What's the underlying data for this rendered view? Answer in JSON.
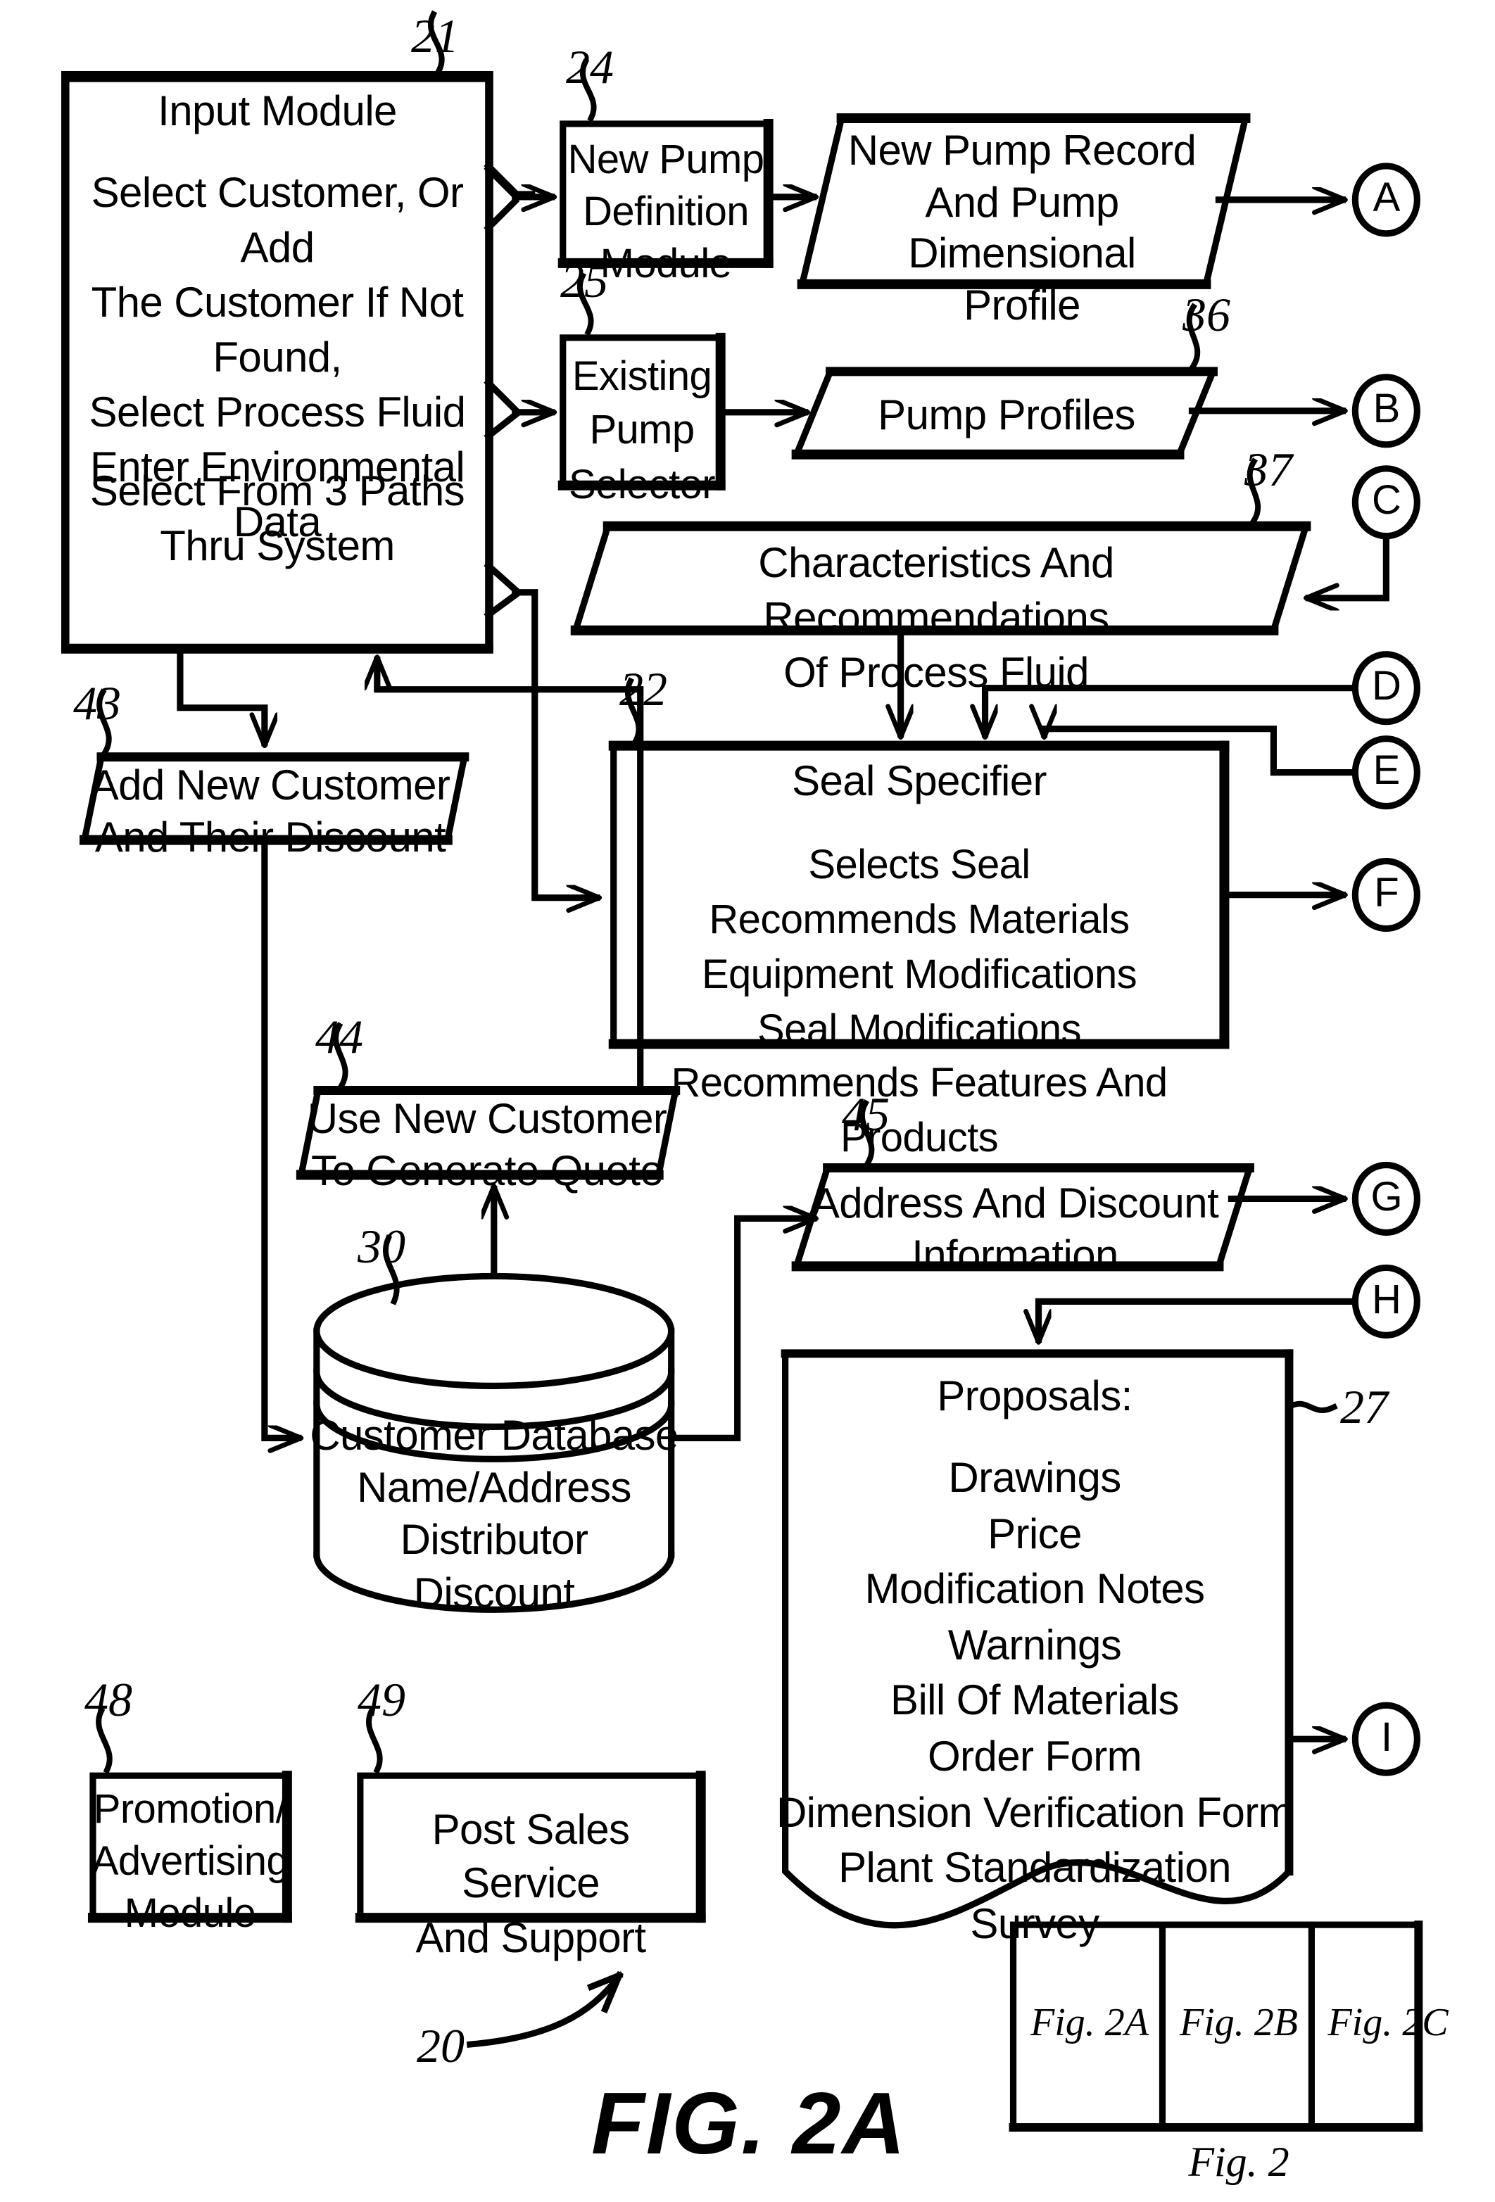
{
  "figure": {
    "caption": "FIG. 2A",
    "system_ref": "20"
  },
  "nodes": {
    "input_module": {
      "ref": "21",
      "title": "Input Module",
      "body": "Select Customer, Or Add\nThe Customer If Not\nFound,\nSelect Process Fluid\nEnter Environmental\nData",
      "body2": "Select From 3 Paths\nThru System"
    },
    "new_pump_definition": {
      "ref": "24",
      "label": "New Pump\nDefinition\nModule"
    },
    "new_pump_record": {
      "label": "New Pump Record\nAnd Pump\nDimensional\nProfile"
    },
    "existing_pump_selector": {
      "ref": "25",
      "label": "Existing\nPump\nSelector"
    },
    "pump_profiles": {
      "ref": "36",
      "label": "Pump Profiles"
    },
    "characteristics": {
      "ref": "37",
      "label": "Characteristics And Recommendations\nOf Process Fluid"
    },
    "seal_specifier": {
      "ref": "22",
      "title": "Seal Specifier",
      "body": "Selects Seal\nRecommends Materials\nEquipment Modifications\nSeal Modifications\nRecommends Features And Products"
    },
    "add_new_customer": {
      "ref": "43",
      "label": "Add New Customer\nAnd Their Discount"
    },
    "use_new_customer": {
      "ref": "44",
      "label": "Use New Customer\nTo Generate Quote"
    },
    "customer_database": {
      "ref": "30",
      "label": "Customer Database\nName/Address\nDistributor\nDiscount"
    },
    "address_discount": {
      "ref": "45",
      "label": "Address And Discount\nInformation"
    },
    "proposals": {
      "ref": "27",
      "title": "Proposals:",
      "items": "Drawings\nPrice\nModification Notes\nWarnings\nBill Of Materials\nOrder Form\nDimension Verification Form\nPlant Standardization Survey"
    },
    "promotion_module": {
      "ref": "48",
      "label": "Promotion/\nAdvertising\nModule"
    },
    "post_sales": {
      "ref": "49",
      "label": "Post Sales Service\nAnd Support"
    }
  },
  "connectors": {
    "a": "A",
    "b": "B",
    "c": "C",
    "d": "D",
    "e": "E",
    "f": "F",
    "g": "G",
    "h": "H",
    "i": "I"
  },
  "sheet_key": {
    "cells": [
      "Fig. 2A",
      "Fig. 2B",
      "Fig. 2C"
    ],
    "caption": "Fig. 2"
  },
  "style": {
    "ink": "#000000",
    "paper": "#ffffff"
  }
}
